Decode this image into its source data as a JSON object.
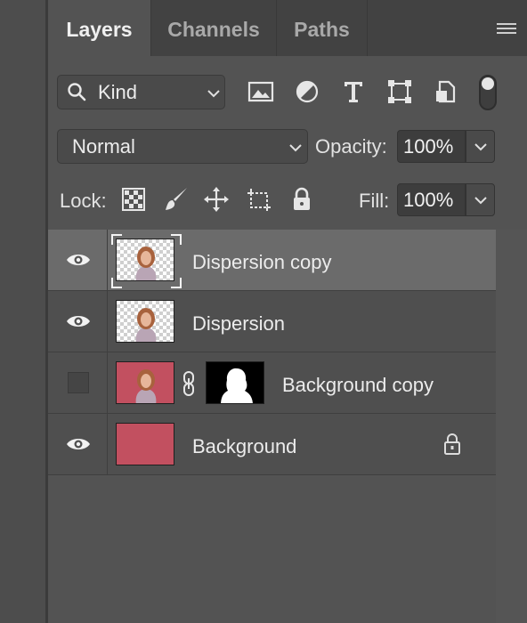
{
  "tabs": [
    {
      "label": "Layers",
      "active": true
    },
    {
      "label": "Channels",
      "active": false
    },
    {
      "label": "Paths",
      "active": false
    }
  ],
  "filter": {
    "kind_label": "Kind",
    "icons": [
      "image-filter-icon",
      "adjustment-filter-icon",
      "type-filter-icon",
      "shape-filter-icon",
      "smart-object-filter-icon"
    ],
    "toggle_on": true
  },
  "blend": {
    "mode": "Normal",
    "opacity_label": "Opacity:",
    "opacity_value": "100%"
  },
  "lock": {
    "label": "Lock:",
    "icons": [
      "lock-transparent-pixels-icon",
      "lock-image-pixels-icon",
      "lock-position-icon",
      "lock-artboard-icon",
      "lock-all-icon"
    ],
    "fill_label": "Fill:",
    "fill_value": "100%"
  },
  "layers": [
    {
      "name": "Dispersion copy",
      "visible": true,
      "selected": true,
      "thumb": "transparent",
      "mask": false,
      "locked": false
    },
    {
      "name": "Dispersion",
      "visible": true,
      "selected": false,
      "thumb": "transparent",
      "mask": false,
      "locked": false
    },
    {
      "name": "Background copy",
      "visible": false,
      "selected": false,
      "thumb": "red",
      "mask": true,
      "locked": false
    },
    {
      "name": "Background",
      "visible": true,
      "selected": false,
      "thumb": "red-plain",
      "mask": false,
      "locked": true
    }
  ],
  "colors": {
    "panel_bg": "#535353",
    "tab_bar_bg": "#424242",
    "selected_row": "#6b6b6b",
    "layer_red": "#c25060"
  }
}
